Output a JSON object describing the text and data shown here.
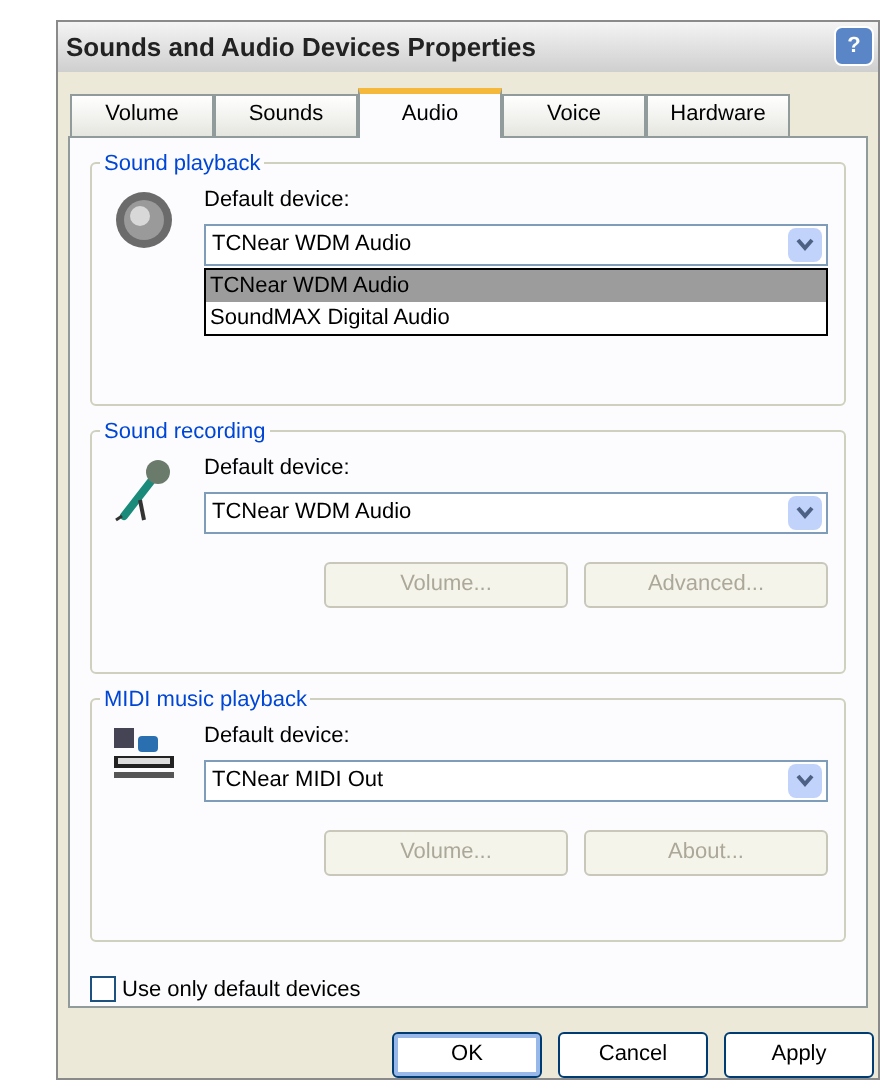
{
  "window": {
    "title": "Sounds and Audio Devices Properties",
    "help_button": "?"
  },
  "tabs": [
    {
      "label": "Volume",
      "selected": false
    },
    {
      "label": "Sounds",
      "selected": false
    },
    {
      "label": "Audio",
      "selected": true
    },
    {
      "label": "Voice",
      "selected": false
    },
    {
      "label": "Hardware",
      "selected": false
    }
  ],
  "groups": [
    {
      "title": "Sound playback",
      "kind": "speaker",
      "device_label": "Default device:",
      "device_value": "TCNear WDM Audio",
      "dropdown_open": true,
      "options": [
        {
          "label": "TCNear WDM Audio",
          "selected": true
        },
        {
          "label": "SoundMAX Digital Audio",
          "selected": false
        }
      ]
    },
    {
      "title": "Sound recording",
      "kind": "microphone",
      "device_label": "Default device:",
      "device_value": "TCNear WDM Audio",
      "dropdown_open": false,
      "buttons": [
        {
          "label": "Volume...",
          "disabled": true
        },
        {
          "label": "Advanced...",
          "disabled": true
        }
      ]
    },
    {
      "title": "MIDI music playback",
      "kind": "midi",
      "device_label": "Default device:",
      "device_value": "TCNear MIDI Out",
      "dropdown_open": false,
      "buttons": [
        {
          "label": "Volume...",
          "disabled": true
        },
        {
          "label": "About...",
          "disabled": true
        }
      ]
    }
  ],
  "checkbox": {
    "label": "Use only default devices",
    "checked": false
  },
  "footer_buttons": [
    {
      "label": "OK",
      "default": true
    },
    {
      "label": "Cancel",
      "default": false
    },
    {
      "label": "Apply",
      "default": false
    }
  ]
}
